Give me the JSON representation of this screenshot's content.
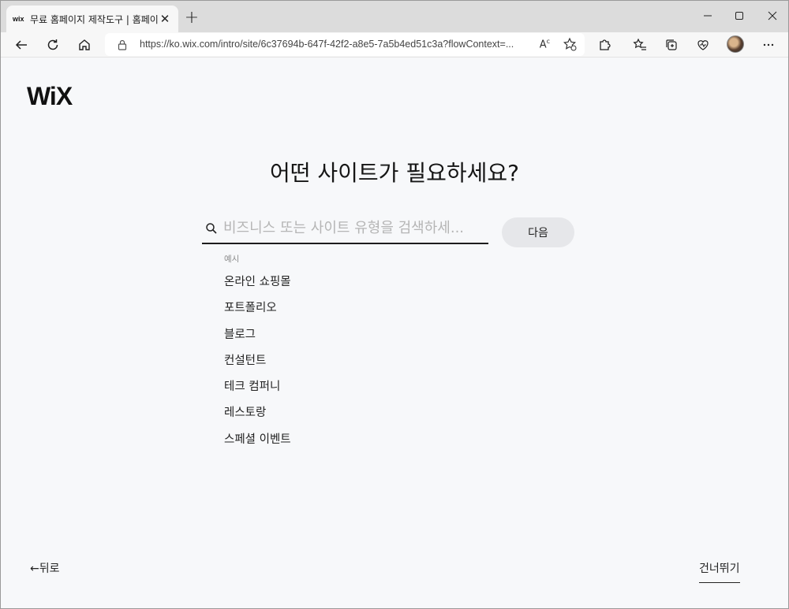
{
  "browser": {
    "tab": {
      "favicon": "wix",
      "title": "무료 홈페이지 제작도구 | 홈페이지"
    },
    "url": "https://ko.wix.com/intro/site/6c37694b-647f-42f2-a8e5-7a5b4ed51c3a?flowContext=...",
    "icons": {
      "new_tab": "plus-icon",
      "close_tab": "close-icon",
      "back": "arrow-left-icon",
      "reload": "refresh-icon",
      "home": "home-icon",
      "lock": "lock-icon",
      "read_aloud": "read-aloud-icon",
      "add_favorite": "star-plus-icon",
      "extensions": "puzzle-icon",
      "favorites": "favorites-icon",
      "collections": "collections-icon",
      "performance": "heart-pulse-icon",
      "profile": "avatar",
      "more": "more-icon"
    }
  },
  "page": {
    "logo": "WiX",
    "headline": "어떤 사이트가 필요하세요?",
    "search": {
      "placeholder": "비즈니스 또는 사이트 유형을 검색하세...",
      "value": ""
    },
    "next_button": "다음",
    "examples_label": "예시",
    "examples": [
      "온라인 쇼핑몰",
      "포트폴리오",
      "블로그",
      "컨설턴트",
      "테크 컴퍼니",
      "레스토랑",
      "스페셜 이벤트"
    ],
    "back": "←뒤로",
    "skip": "건너뛰기"
  }
}
